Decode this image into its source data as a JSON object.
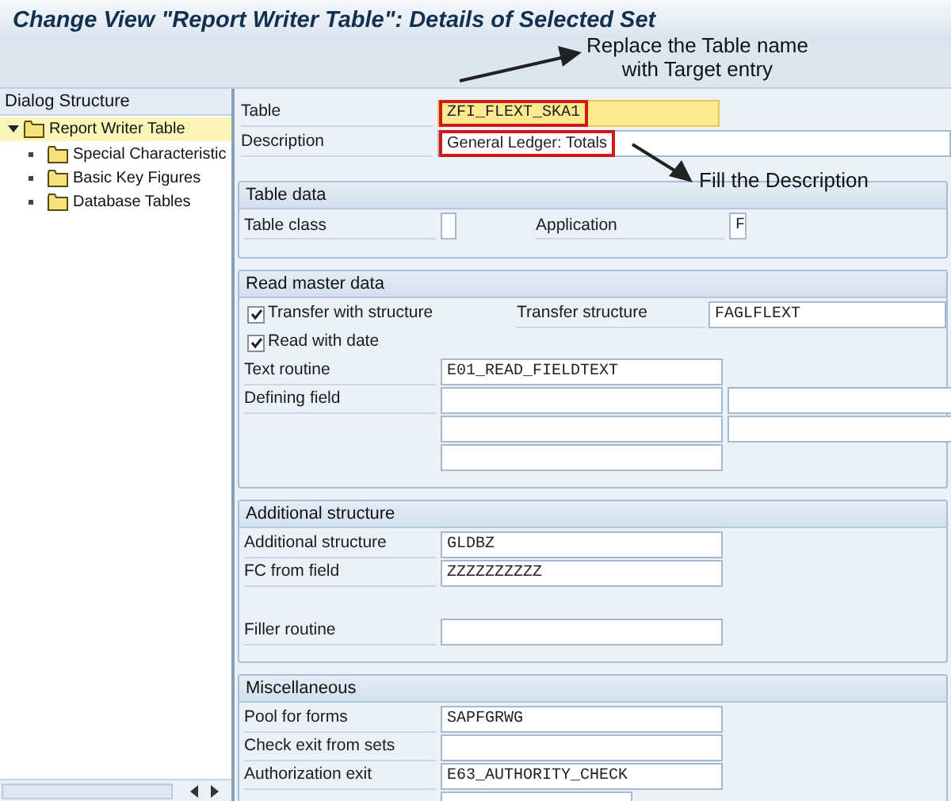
{
  "window": {
    "title": "Change View \"Report Writer Table\": Details of Selected Set"
  },
  "sidebar": {
    "title": "Dialog Structure",
    "items": [
      {
        "label": "Report Writer Table",
        "selected": true,
        "expanded": true,
        "children": [
          {
            "label": "Special Characteristic",
            "selected": false
          },
          {
            "label": "Basic Key Figures",
            "selected": false
          },
          {
            "label": "Database Tables",
            "selected": false
          }
        ]
      }
    ]
  },
  "header_fields": [
    {
      "label": "Table",
      "value": "ZFI_FLEXT_SKA1",
      "highlighted": true,
      "kind": "key"
    },
    {
      "label": "Description",
      "value": "General Ledger: Totals",
      "highlighted": true,
      "kind": "text"
    }
  ],
  "annotations": [
    {
      "text": "Replace the Table name with Target entry"
    },
    {
      "text": "Fill the Description"
    }
  ],
  "sections": [
    {
      "title": "Table data",
      "rows": [
        {
          "kind": "short-pair",
          "label": "Table class",
          "right_label": "Application",
          "right_value": "F"
        }
      ]
    },
    {
      "title": "Read master data",
      "rows": [
        {
          "kind": "checkbox",
          "label": "Transfer with structure",
          "checked": true,
          "right_label": "Transfer structure",
          "right_value": "FAGLFLEXT"
        },
        {
          "kind": "checkbox",
          "label": "Read with date",
          "checked": true
        },
        {
          "kind": "field",
          "label": "Text routine",
          "value": "E01_READ_FIELDTEXT"
        },
        {
          "kind": "field",
          "label": "Defining field",
          "extra_column": true
        },
        {
          "kind": "field",
          "extra_column": true
        },
        {
          "kind": "field",
          "extra_column": false
        }
      ]
    },
    {
      "title": "Additional structure",
      "rows": [
        {
          "kind": "field",
          "label": "Additional structure",
          "value": "GLDBZ"
        },
        {
          "kind": "field",
          "label": "FC from field",
          "value": "ZZZZZZZZZZ"
        },
        {
          "kind": "field",
          "label": "Filler routine",
          "gap_before": true
        }
      ]
    },
    {
      "title": "Miscellaneous",
      "rows": [
        {
          "kind": "field",
          "label": "Pool for forms",
          "value": "SAPFGRWG"
        },
        {
          "kind": "field",
          "label": "Check exit from sets"
        },
        {
          "kind": "field",
          "label": "Authorization exit",
          "value": "E63_AUTHORITY_CHECK"
        },
        {
          "kind": "short-field"
        }
      ]
    }
  ]
}
